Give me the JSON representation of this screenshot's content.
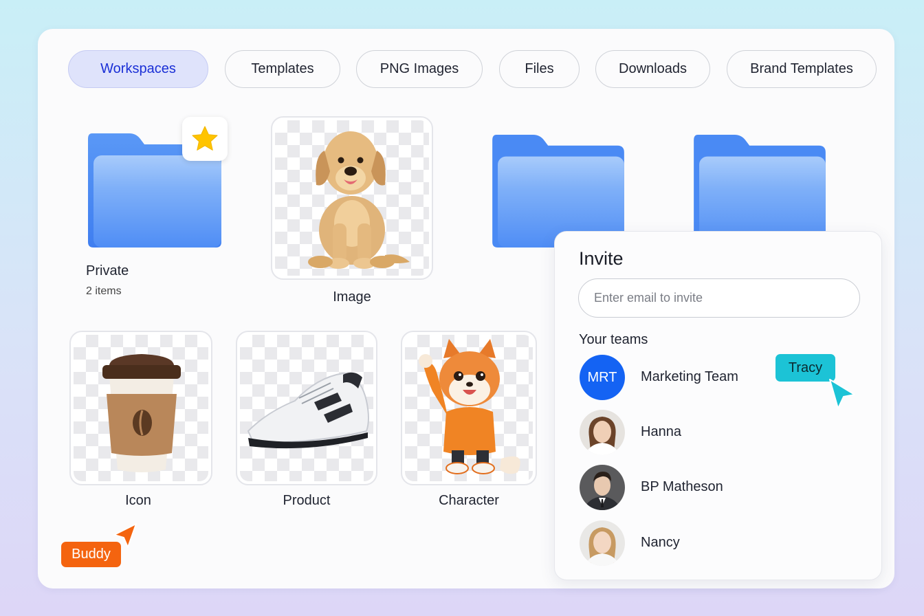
{
  "tabs": [
    {
      "label": "Workspaces",
      "active": true
    },
    {
      "label": "Templates",
      "active": false
    },
    {
      "label": "PNG Images",
      "active": false
    },
    {
      "label": "Files",
      "active": false
    },
    {
      "label": "Downloads",
      "active": false
    },
    {
      "label": "Brand Templates",
      "active": false
    }
  ],
  "items": {
    "private": {
      "name": "Private",
      "count": "2 items",
      "starred": true
    },
    "image": {
      "name": "Image"
    },
    "icon": {
      "name": "Icon"
    },
    "product": {
      "name": "Product"
    },
    "character": {
      "name": "Character"
    }
  },
  "invite": {
    "title": "Invite",
    "email_placeholder": "Enter email to invite",
    "teams_label": "Your teams",
    "members": [
      {
        "name": "Marketing Team",
        "initials": "MRT",
        "kind": "team"
      },
      {
        "name": "Hanna",
        "kind": "person"
      },
      {
        "name": "BP Matheson",
        "kind": "person"
      },
      {
        "name": "Nancy",
        "kind": "person"
      }
    ]
  },
  "collaborators": [
    {
      "name": "Tracy",
      "color": "#1cc3d6"
    },
    {
      "name": "Buddy",
      "color": "#f4640f"
    }
  ],
  "colors": {
    "accent_active_tab": "#1a2fd6",
    "folder_blue": "#4f8df5",
    "star": "#ffc400"
  }
}
